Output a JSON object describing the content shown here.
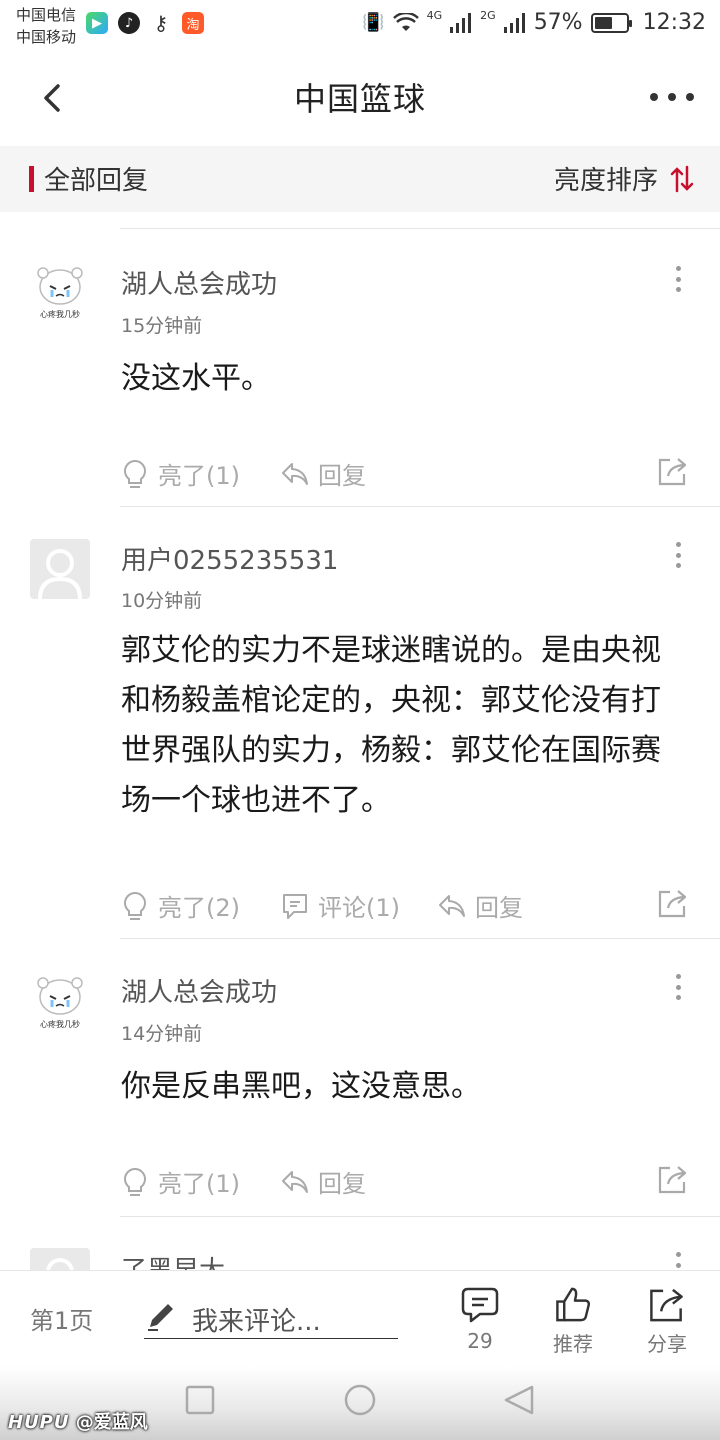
{
  "status_bar": {
    "carrier_1": "中国电信",
    "carrier_2": "中国移动",
    "net_4g": "4G",
    "net_2g": "2G",
    "battery_percent": "57%",
    "battery_level": 0.57,
    "time": "12:32",
    "app_icons": [
      "video-app-icon",
      "tiktok-icon",
      "key-icon",
      "taobao-icon"
    ]
  },
  "header": {
    "title": "中国篮球"
  },
  "sort_bar": {
    "label": "全部回复",
    "sort_label": "亮度排序",
    "accent_color": "#c8102e"
  },
  "comments": [
    {
      "username": "湖人总会成功",
      "time": "15分钟前",
      "text": "没这水平。",
      "like_label": "亮了(1)",
      "reply_label": "回复",
      "avatar_caption": "心疼我几秒"
    },
    {
      "username": "用户0255235531",
      "time": "10分钟前",
      "text": "郭艾伦的实力不是球迷瞎说的。是由央视和杨毅盖棺论定的，央视：郭艾伦没有打世界强队的实力，杨毅：郭艾伦在国际赛场一个球也进不了。",
      "like_label": "亮了(2)",
      "comment_label": "评论(1)",
      "reply_label": "回复"
    },
    {
      "username": "湖人总会成功",
      "time": "14分钟前",
      "text": "你是反串黑吧，这没意思。",
      "like_label": "亮了(1)",
      "reply_label": "回复",
      "avatar_caption": "心疼我几秒"
    },
    {
      "username": "了黑早大"
    }
  ],
  "bottom_bar": {
    "page": "第1页",
    "input_placeholder": "我来评论...",
    "comment_count": "29",
    "recommend_label": "推荐",
    "share_label": "分享"
  },
  "watermark": {
    "brand": "HUPU",
    "author": "@爱蓝风"
  }
}
